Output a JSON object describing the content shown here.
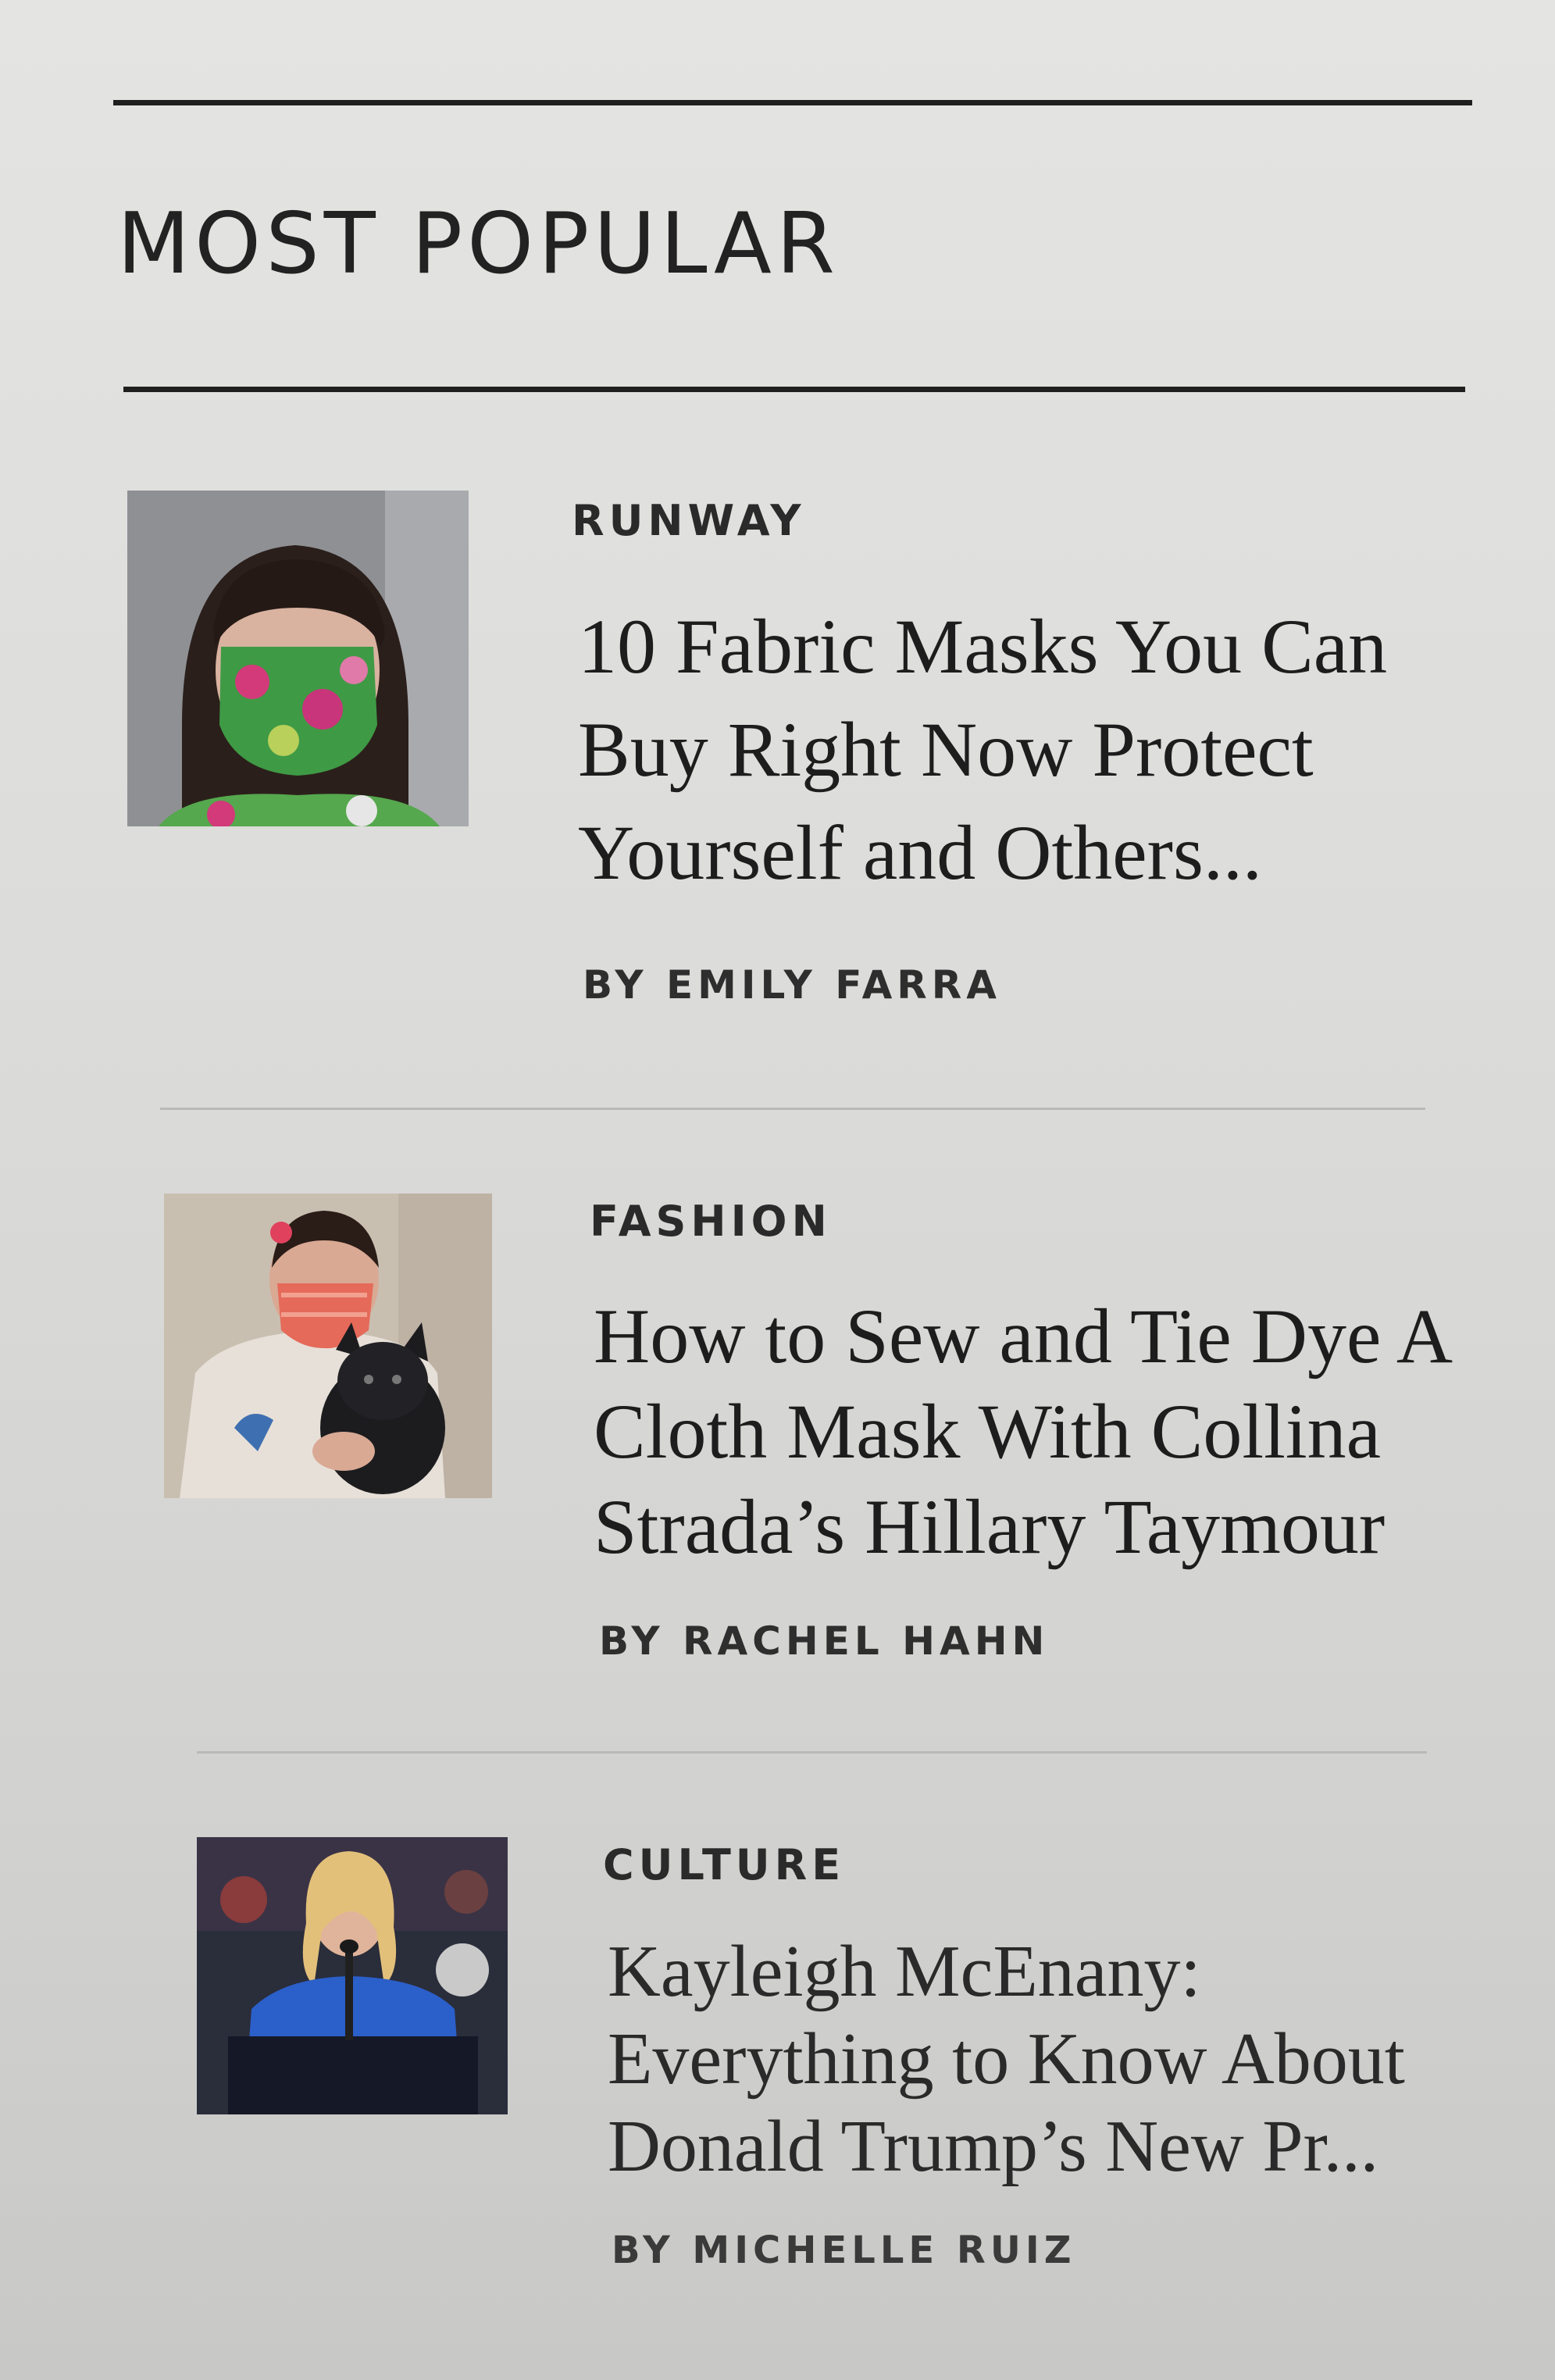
{
  "section": {
    "title": "MOST POPULAR"
  },
  "articles": [
    {
      "category": "RUNWAY",
      "headline": "10 Fabric Masks You Can Buy Right Now Protect Yourself and Others...",
      "byline": "BY EMILY FARRA"
    },
    {
      "category": "FASHION",
      "headline": "How to Sew and Tie Dye A Cloth Mask With Collina Strada’s Hillary Taymour",
      "byline": "BY RACHEL HAHN"
    },
    {
      "category": "CULTURE",
      "headline": "Kayleigh McEnany: Everything to Know About Donald Trump’s New Pr...",
      "byline": "BY MICHELLE RUIZ"
    }
  ]
}
